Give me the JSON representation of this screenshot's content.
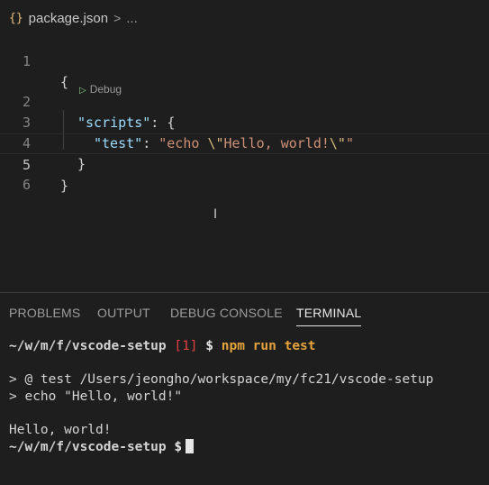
{
  "breadcrumb": {
    "icon_glyph": "{}",
    "file": "package.json",
    "chevron": ">",
    "ellipsis": "..."
  },
  "editor": {
    "codelens_label": "Debug",
    "lines": [
      {
        "number": "1",
        "brace_open": "{"
      },
      {
        "number": "2",
        "key": "\"scripts\"",
        "colon": ": ",
        "brace": "{"
      },
      {
        "number": "3",
        "key": "\"test\"",
        "colon": ": ",
        "str_a": "\"echo ",
        "esc_a": "\\\"",
        "str_b": "Hello, world!",
        "esc_b": "\\\"",
        "str_c": "\""
      },
      {
        "number": "4",
        "brace": "}"
      },
      {
        "number": "5",
        "brace": "}"
      },
      {
        "number": "6"
      }
    ]
  },
  "panel": {
    "tabs": [
      {
        "label": "PROBLEMS",
        "active": false
      },
      {
        "label": "OUTPUT",
        "active": false
      },
      {
        "label": "DEBUG CONSOLE",
        "active": false
      },
      {
        "label": "TERMINAL",
        "active": true
      }
    ]
  },
  "terminal": {
    "prompt1_path": "~/w/m/f/vscode-setup",
    "prompt1_code": "[1]",
    "prompt1_symbol": "$",
    "prompt1_command": "npm run test",
    "out1": "> @ test /Users/jeongho/workspace/my/fc21/vscode-setup",
    "out2": "> echo \"Hello, world!\"",
    "out3": "Hello, world!",
    "prompt2_path": "~/w/m/f/vscode-setup",
    "prompt2_symbol": "$"
  },
  "colors": {
    "background": "#1e1e1e",
    "key": "#9cdcfe",
    "string": "#ce9178",
    "command": "#e5a33c",
    "error_code": "#e04040"
  }
}
